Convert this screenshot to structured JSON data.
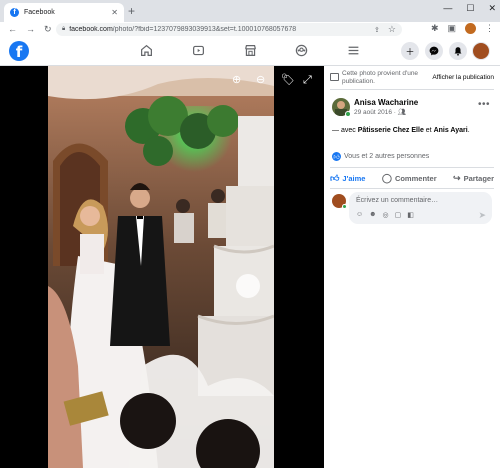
{
  "browser": {
    "tab_title": "Facebook",
    "tab_close": "✕",
    "new_tab": "+",
    "window_controls": [
      "—",
      "☐",
      "✕"
    ],
    "url_host": "facebook.com",
    "url_path": "/photo/?fbid=1237079893039913&set=t.100010768057678",
    "toolbar_icons": [
      "puzzle-icon",
      "sidepanel-icon",
      "profile-icon",
      "menu-icon"
    ]
  },
  "fb_header": {
    "logo": "f",
    "nav_icons": [
      "home-icon",
      "watch-icon",
      "marketplace-icon",
      "groups-icon",
      "menu-icon"
    ],
    "right_icons": [
      "create-icon",
      "messenger-icon",
      "notifications-icon",
      "account-avatar"
    ]
  },
  "viewer": {
    "controls": [
      "zoom-in-icon",
      "zoom-out-icon",
      "tag-icon",
      "fullscreen-icon"
    ]
  },
  "panel": {
    "provenance_text": "Cette photo provient d'une publication.",
    "provenance_link": "Afficher la publication",
    "author": "Anisa Wacharine",
    "date": "29 août 2016 · ",
    "audience_icon": "friends-icon",
    "more": "•••",
    "caption_prefix": "— avec ",
    "caption_tag1": "Pâtisserie Chez Elle",
    "caption_mid": " et ",
    "caption_tag2": "Anis Ayari",
    "caption_end": ".",
    "reactions_text": "Vous et 2 autres personnes",
    "actions": {
      "like": "J'aime",
      "comment": "Commenter",
      "share": "Partager"
    },
    "comment_placeholder": "Écrivez un commentaire…",
    "comment_tools": [
      "emoji-icon",
      "camera-icon",
      "gif-icon",
      "sticker-icon"
    ]
  }
}
